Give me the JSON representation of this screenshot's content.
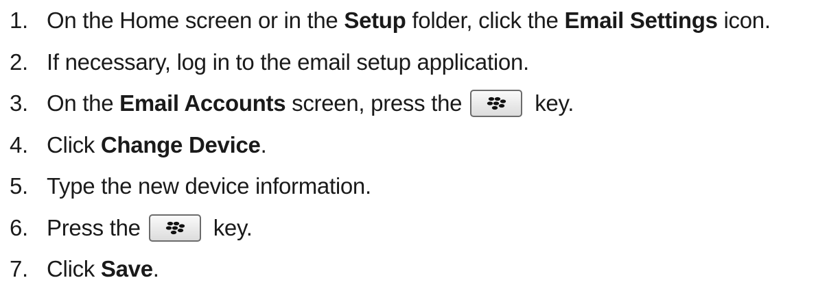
{
  "steps": [
    {
      "number": "1.",
      "segments": [
        {
          "text": "On the Home screen or in the ",
          "bold": false
        },
        {
          "text": "Setup",
          "bold": true
        },
        {
          "text": " folder, click the ",
          "bold": false
        },
        {
          "text": "Email Settings",
          "bold": true
        },
        {
          "text": " icon.",
          "bold": false
        }
      ]
    },
    {
      "number": "2.",
      "segments": [
        {
          "text": "If necessary, log in to the email setup application.",
          "bold": false
        }
      ]
    },
    {
      "number": "3.",
      "segments": [
        {
          "text": "On the ",
          "bold": false
        },
        {
          "text": "Email Accounts",
          "bold": true
        },
        {
          "text": " screen, press the",
          "bold": false
        },
        {
          "key": "blackberry-menu-key-icon"
        },
        {
          "text": "key.",
          "bold": false
        }
      ]
    },
    {
      "number": "4.",
      "segments": [
        {
          "text": "Click ",
          "bold": false
        },
        {
          "text": "Change Device",
          "bold": true
        },
        {
          "text": ".",
          "bold": false
        }
      ]
    },
    {
      "number": "5.",
      "segments": [
        {
          "text": "Type the new device information.",
          "bold": false
        }
      ]
    },
    {
      "number": "6.",
      "segments": [
        {
          "text": "Press the",
          "bold": false
        },
        {
          "key": "blackberry-menu-key-icon"
        },
        {
          "text": "key.",
          "bold": false
        }
      ]
    },
    {
      "number": "7.",
      "segments": [
        {
          "text": "Click ",
          "bold": false
        },
        {
          "text": "Save",
          "bold": true
        },
        {
          "text": ".",
          "bold": false
        }
      ]
    }
  ]
}
